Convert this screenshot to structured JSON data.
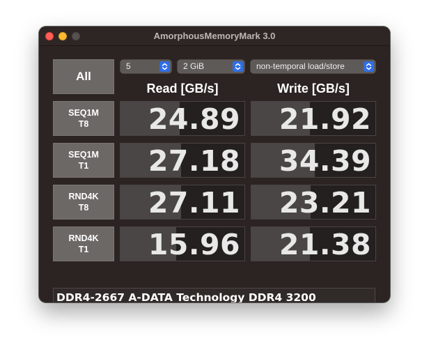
{
  "window": {
    "title": "AmorphousMemoryMark 3.0"
  },
  "controls": {
    "all_label": "All",
    "count": "5",
    "size": "2 GiB",
    "mode": "non-temporal load/store"
  },
  "headers": {
    "read": "Read [GB/s]",
    "write": "Write [GB/s]"
  },
  "tests": [
    {
      "line1": "SEQ1M",
      "line2": "T8",
      "read": "24.89",
      "write": "21.92",
      "read_fill": 0.48,
      "write_fill": 0.47
    },
    {
      "line1": "SEQ1M",
      "line2": "T1",
      "read": "27.18",
      "write": "34.39",
      "read_fill": 0.49,
      "write_fill": 0.51
    },
    {
      "line1": "RND4K",
      "line2": "T8",
      "read": "27.11",
      "write": "23.21",
      "read_fill": 0.49,
      "write_fill": 0.48
    },
    {
      "line1": "RND4K",
      "line2": "T1",
      "read": "15.96",
      "write": "21.38",
      "read_fill": 0.45,
      "write_fill": 0.47
    }
  ],
  "comment": "DDR4-2667 A-DATA Technology DDR4 3200",
  "colors": {
    "accent": "#2f6ee6",
    "window_bg": "#2c2422",
    "button_bg": "#6c6866",
    "bar_fill": "#4a4646",
    "close": "#ff5f57",
    "minimize": "#febc2e"
  }
}
